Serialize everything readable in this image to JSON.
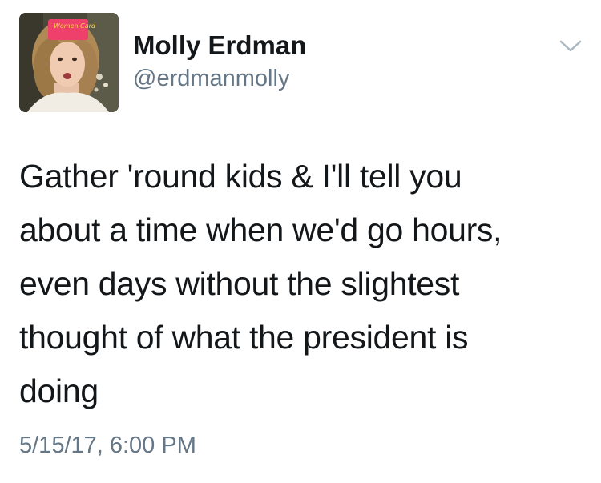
{
  "author": {
    "name": "Molly Erdman",
    "handle": "@erdmanmolly",
    "avatar_icon": "profile-photo",
    "badge_text": "Women Card"
  },
  "menu": {
    "icon": "chevron-down-icon"
  },
  "tweet": {
    "text": "Gather 'round kids & I'll tell you\nabout a time when we'd go hours,\neven days without the slightest\nthought of what the president is\ndoing",
    "timestamp": "5/15/17, 6:00 PM"
  },
  "colors": {
    "text": "#14171a",
    "secondary": "#657786",
    "chevron": "#aab8c2",
    "background": "#ffffff"
  }
}
